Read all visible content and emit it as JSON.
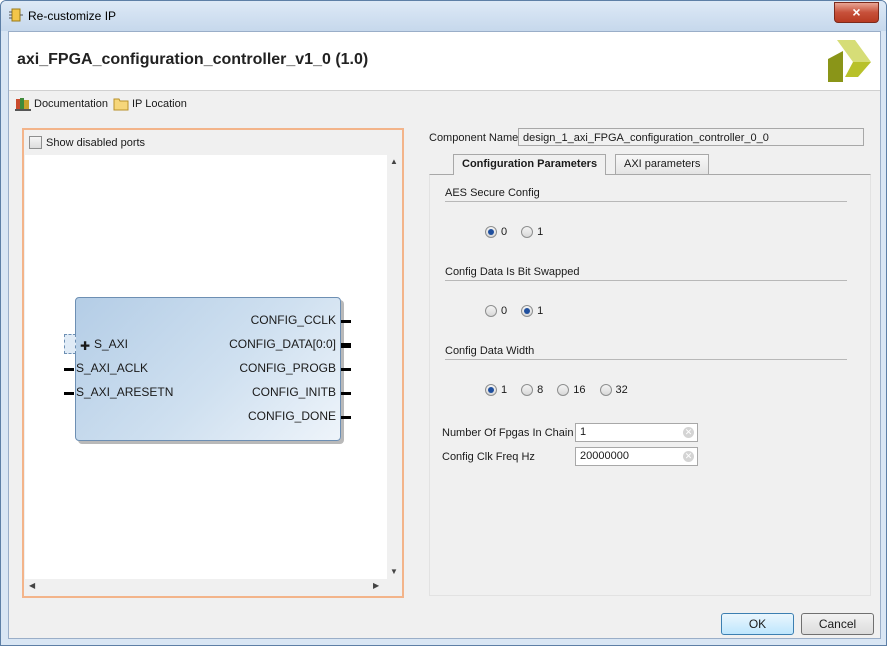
{
  "window": {
    "title": "Re-customize IP",
    "close_glyph": "×"
  },
  "header": {
    "ip_title": "axi_FPGA_configuration_controller_v1_0 (1.0)",
    "logo_icon": "xilinx-logo"
  },
  "toolbar": {
    "documentation_label": "Documentation",
    "ip_location_label": "IP Location"
  },
  "left_panel": {
    "show_disabled_ports_label": "Show disabled ports",
    "show_disabled_ports_checked": false,
    "block": {
      "left_ports": [
        "S_AXI",
        "S_AXI_ACLK",
        "S_AXI_ARESETN"
      ],
      "right_ports": [
        "CONFIG_CCLK",
        "CONFIG_DATA[0:0]",
        "CONFIG_PROGB",
        "CONFIG_INITB",
        "CONFIG_DONE"
      ]
    }
  },
  "right_panel": {
    "component_name_label": "Component Name",
    "component_name_value": "design_1_axi_FPGA_configuration_controller_0_0",
    "tabs": [
      "Configuration Parameters",
      "AXI parameters"
    ],
    "active_tab": "Configuration Parameters",
    "groups": [
      {
        "label": "AES Secure Config",
        "options": [
          "0",
          "1"
        ],
        "selected": "0"
      },
      {
        "label": "Config Data Is Bit Swapped",
        "options": [
          "0",
          "1"
        ],
        "selected": "1"
      },
      {
        "label": "Config Data Width",
        "options": [
          "1",
          "8",
          "16",
          "32"
        ],
        "selected": "1"
      }
    ],
    "params": [
      {
        "label": "Number Of Fpgas In Chain",
        "value": "1"
      },
      {
        "label": "Config Clk Freq Hz",
        "value": "20000000"
      }
    ]
  },
  "footer": {
    "ok_label": "OK",
    "cancel_label": "Cancel"
  }
}
